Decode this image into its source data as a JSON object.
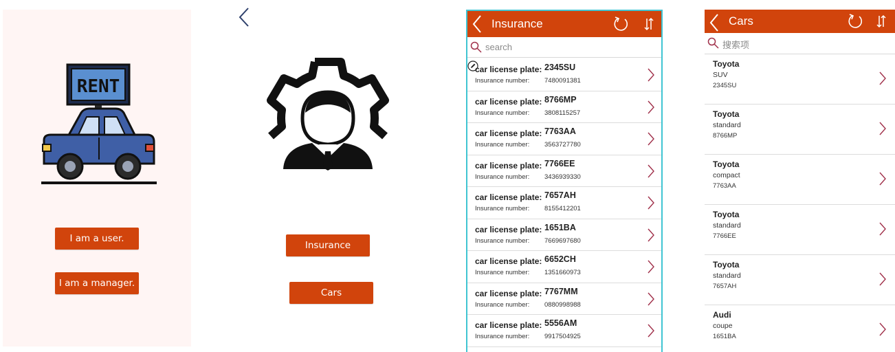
{
  "screens": {
    "welcome": {
      "logo_text": "RENT",
      "user_button": "I am a user.",
      "manager_button": "I am a manager."
    },
    "manager": {
      "insurance_button": "Insurance",
      "cars_button": "Cars"
    },
    "insurance": {
      "title": "Insurance",
      "search_placeholder": "search",
      "rows": [
        {
          "plate_label": "car license plate:",
          "plate": "2345SU",
          "insurance_label": "Insurance number:",
          "insurance_number": "7480091381"
        },
        {
          "plate_label": "car license plate:",
          "plate": "8766MP",
          "insurance_label": "Insurance number:",
          "insurance_number": "3808115257"
        },
        {
          "plate_label": "car license plate:",
          "plate": "7763AA",
          "insurance_label": "Insurance number:",
          "insurance_number": "3563727780"
        },
        {
          "plate_label": "car license plate:",
          "plate": "7766EE",
          "insurance_label": "Insurance number:",
          "insurance_number": "3436939330"
        },
        {
          "plate_label": "car license plate:",
          "plate": "7657AH",
          "insurance_label": "Insurance number:",
          "insurance_number": "8155412201"
        },
        {
          "plate_label": "car license plate:",
          "plate": "1651BA",
          "insurance_label": "Insurance number:",
          "insurance_number": "7669697680"
        },
        {
          "plate_label": "car license plate:",
          "plate": "6652CH",
          "insurance_label": "Insurance number:",
          "insurance_number": "1351660973"
        },
        {
          "plate_label": "car license plate:",
          "plate": "7767MM",
          "insurance_label": "Insurance number:",
          "insurance_number": "0880998988"
        },
        {
          "plate_label": "car license plate:",
          "plate": "5556AM",
          "insurance_label": "Insurance number:",
          "insurance_number": "9917504925"
        }
      ]
    },
    "cars": {
      "title": "Cars",
      "search_placeholder": "搜索项",
      "rows": [
        {
          "brand": "Toyota",
          "type": "SUV",
          "plate": "2345SU"
        },
        {
          "brand": "Toyota",
          "type": "standard",
          "plate": "8766MP"
        },
        {
          "brand": "Toyota",
          "type": "compact",
          "plate": "7763AA"
        },
        {
          "brand": "Toyota",
          "type": "standard",
          "plate": "7766EE"
        },
        {
          "brand": "Toyota",
          "type": "standard",
          "plate": "7657AH"
        },
        {
          "brand": "Audi",
          "type": "coupe",
          "plate": "1651BA"
        }
      ]
    }
  },
  "colors": {
    "accent": "#d1440c",
    "welcome_bg": "#fff5f4",
    "car_body": "#3f5fa6",
    "selection_border": "#3fc4d2",
    "chevron": "#a0304a"
  },
  "icons": [
    "rent-car-icon",
    "chevron-left-icon",
    "gear-person-icon",
    "refresh-icon",
    "sort-icon",
    "search-icon",
    "edit-icon",
    "chevron-right-icon"
  ]
}
